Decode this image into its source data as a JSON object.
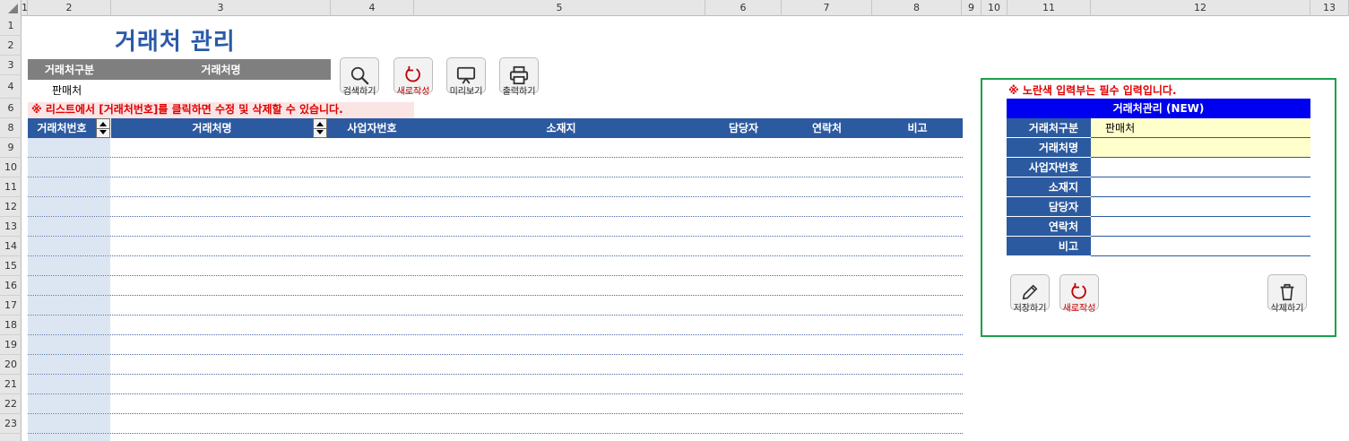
{
  "columns": [
    "1",
    "2",
    "3",
    "4",
    "5",
    "6",
    "7",
    "8",
    "9",
    "10",
    "11",
    "12",
    "13"
  ],
  "rows": [
    "1",
    "2",
    "3",
    "4",
    "6",
    "8",
    "9",
    "10",
    "11",
    "12",
    "13",
    "14",
    "15",
    "16",
    "17",
    "18",
    "19",
    "20",
    "21",
    "22",
    "23"
  ],
  "title": "거래처 관리",
  "condition": {
    "type_header": "거래처구분",
    "name_header": "거래처명",
    "type_value": "판매처"
  },
  "toolbar": {
    "search": "검색하기",
    "new": "새로작성",
    "preview": "미리보기",
    "print": "출력하기"
  },
  "notice": "※ 리스트에서 [거래처번호]를 클릭하면 수정 및 삭제할 수 있습니다.",
  "list_headers": {
    "number": "거래처번호",
    "name": "거래처명",
    "biz_no": "사업자번호",
    "address": "소재지",
    "manager": "담당자",
    "contact": "연락처",
    "memo": "비고"
  },
  "form": {
    "required_note": "※ 노란색 입력부는 필수 입력입니다.",
    "title": "거래처관리 (NEW)",
    "fields": [
      {
        "label": "거래처구분",
        "value": "판매처"
      },
      {
        "label": "거래처명",
        "value": ""
      },
      {
        "label": "사업자번호",
        "value": ""
      },
      {
        "label": "소재지",
        "value": ""
      },
      {
        "label": "담당자",
        "value": ""
      },
      {
        "label": "연락처",
        "value": ""
      },
      {
        "label": "비고",
        "value": ""
      }
    ],
    "save": "저장하기",
    "new": "새로작성",
    "delete": "삭제하기"
  },
  "colors": {
    "title_blue": "#2a5aa8",
    "header_blue": "#2c5aa0",
    "form_title_blue": "#0000f0",
    "required_yellow": "#ffffcc",
    "notice_red": "#e00000",
    "panel_border_green": "#1aa04a"
  }
}
